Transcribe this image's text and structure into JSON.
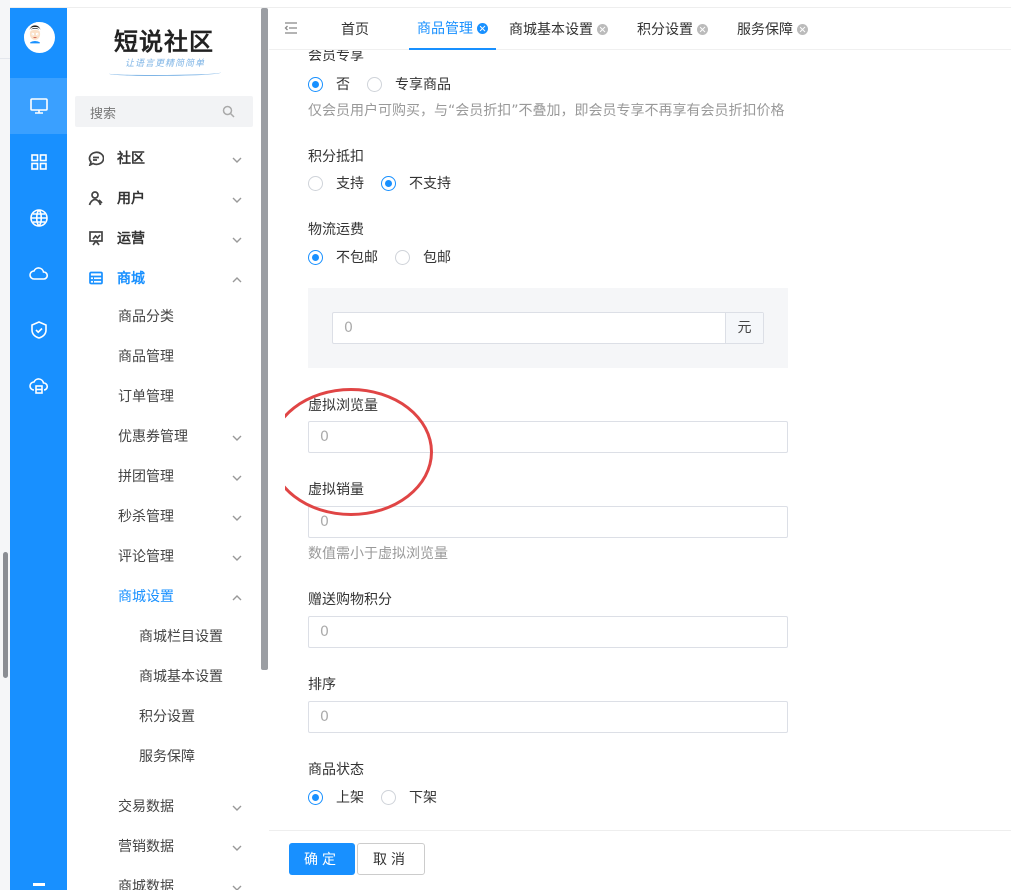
{
  "brand": {
    "title": "短说社区",
    "subtitle": "让语言更精简简单"
  },
  "search": {
    "placeholder": "搜索"
  },
  "menu": {
    "top": [
      {
        "label": "社区",
        "icon": "chat-icon"
      },
      {
        "label": "用户",
        "icon": "user-icon"
      },
      {
        "label": "运营",
        "icon": "presentation-icon"
      },
      {
        "label": "商城",
        "icon": "store-icon"
      }
    ],
    "sub": [
      {
        "label": "商品分类"
      },
      {
        "label": "商品管理"
      },
      {
        "label": "订单管理"
      },
      {
        "label": "优惠券管理"
      },
      {
        "label": "拼团管理"
      },
      {
        "label": "秒杀管理"
      },
      {
        "label": "评论管理"
      },
      {
        "label": "商城设置"
      }
    ],
    "sub2": [
      {
        "label": "商城栏目设置"
      },
      {
        "label": "商城基本设置"
      },
      {
        "label": "积分设置"
      },
      {
        "label": "服务保障"
      }
    ],
    "more": [
      {
        "label": "交易数据"
      },
      {
        "label": "营销数据"
      },
      {
        "label": "商城数据"
      }
    ]
  },
  "tabs": [
    {
      "label": "首页"
    },
    {
      "label": "商品管理"
    },
    {
      "label": "商城基本设置"
    },
    {
      "label": "积分设置"
    },
    {
      "label": "服务保障"
    }
  ],
  "form": {
    "member_exclusive": {
      "label": "会员专享",
      "options": [
        "否",
        "专享商品"
      ],
      "selected": "否",
      "hint": "仅会员用户可购买，与“会员折扣”不叠加，即会员专享不再享有会员折扣价格"
    },
    "points_deduction": {
      "label": "积分抵扣",
      "options": [
        "支持",
        "不支持"
      ],
      "selected": "不支持"
    },
    "shipping": {
      "label": "物流运费",
      "options": [
        "不包邮",
        "包邮"
      ],
      "selected": "不包邮",
      "fee_value": "0",
      "unit": "元"
    },
    "virtual_views": {
      "label": "虚拟浏览量",
      "value": "0"
    },
    "virtual_sales": {
      "label": "虚拟销量",
      "value": "0",
      "hint": "数值需小于虚拟浏览量"
    },
    "gift_points": {
      "label": "赠送购物积分",
      "value": "0"
    },
    "sort": {
      "label": "排序",
      "value": "0"
    },
    "status": {
      "label": "商品状态",
      "options": [
        "上架",
        "下架"
      ],
      "selected": "上架"
    }
  },
  "footer": {
    "confirm": "确定",
    "cancel": "取消"
  },
  "colors": {
    "accent": "#1890ff",
    "annotation": "#e04545"
  }
}
